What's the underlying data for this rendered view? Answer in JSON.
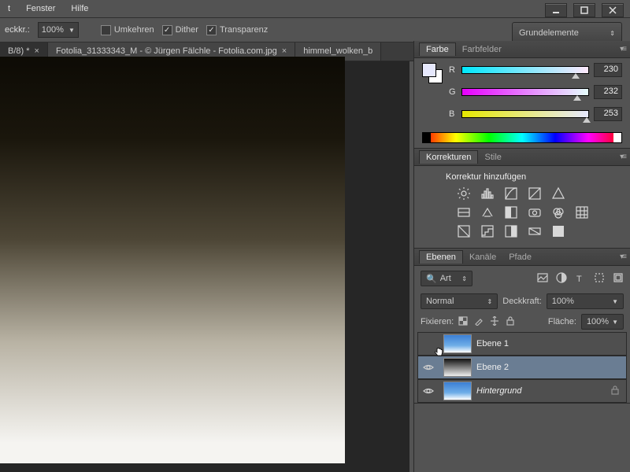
{
  "menu": {
    "items": [
      "t",
      "Fenster",
      "Hilfe"
    ]
  },
  "options": {
    "opacity_label": "eckkr.:",
    "opacity_value": "100%",
    "invert": "Umkehren",
    "dither": "Dither",
    "transparency": "Transparenz"
  },
  "workspace_selector": "Grundelemente",
  "document_tabs": [
    {
      "label": "B/8) *",
      "active": true
    },
    {
      "label": "Fotolia_31333343_M - © Jürgen Fälchle - Fotolia.com.jpg",
      "active": false
    },
    {
      "label": "himmel_wolken_b",
      "active": false
    }
  ],
  "farbe_panel": {
    "tabs": [
      "Farbe",
      "Farbfelder"
    ],
    "rgb": {
      "R": 230,
      "G": 232,
      "B": 253
    }
  },
  "korrekturen_panel": {
    "tabs": [
      "Korrekturen",
      "Stile"
    ],
    "heading": "Korrektur hinzufügen"
  },
  "ebenen_panel": {
    "tabs": [
      "Ebenen",
      "Kanäle",
      "Pfade"
    ],
    "filter_kind": "Art",
    "blend_mode": "Normal",
    "opacity_label": "Deckkraft:",
    "opacity_value": "100%",
    "fill_label": "Fläche:",
    "fill_value": "100%",
    "lock_label": "Fixieren:",
    "layers": [
      {
        "name": "Ebene 1",
        "visible": false,
        "thumb": "sky",
        "selected": false,
        "locked": false
      },
      {
        "name": "Ebene 2",
        "visible": true,
        "thumb": "grad",
        "selected": true,
        "locked": false
      },
      {
        "name": "Hintergrund",
        "visible": true,
        "thumb": "sky",
        "selected": false,
        "locked": true,
        "italic": true
      }
    ]
  }
}
